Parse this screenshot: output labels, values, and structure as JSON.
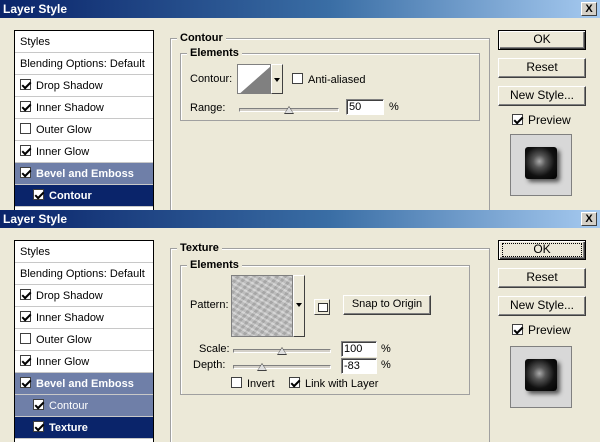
{
  "window1": {
    "title": "Layer Style",
    "close": "X",
    "sidebar": [
      {
        "label": "Styles",
        "checkbox": false,
        "checked": false,
        "state": "normal"
      },
      {
        "label": "Blending Options: Default",
        "checkbox": false,
        "checked": false,
        "state": "normal"
      },
      {
        "label": "Drop Shadow",
        "checkbox": true,
        "checked": true,
        "state": "normal"
      },
      {
        "label": "Inner Shadow",
        "checkbox": true,
        "checked": true,
        "state": "normal"
      },
      {
        "label": "Outer Glow",
        "checkbox": true,
        "checked": false,
        "state": "normal"
      },
      {
        "label": "Inner Glow",
        "checkbox": true,
        "checked": true,
        "state": "normal"
      },
      {
        "label": "Bevel and Emboss",
        "checkbox": true,
        "checked": true,
        "state": "selected-parent"
      },
      {
        "label": "Contour",
        "checkbox": true,
        "checked": true,
        "state": "selected"
      }
    ],
    "panel_title": "Contour",
    "group_title": "Elements",
    "contour_label": "Contour:",
    "anti_aliased_label": "Anti-aliased",
    "anti_aliased_checked": false,
    "range_label": "Range:",
    "range_value": "50",
    "range_unit": "%",
    "range_level_percent": 50,
    "ok_label": "OK",
    "reset_label": "Reset",
    "new_style_label": "New Style...",
    "preview_label": "Preview",
    "preview_checked": true
  },
  "window2": {
    "title": "Layer Style",
    "close": "X",
    "sidebar": [
      {
        "label": "Styles",
        "checkbox": false,
        "checked": false,
        "state": "normal"
      },
      {
        "label": "Blending Options: Default",
        "checkbox": false,
        "checked": false,
        "state": "normal"
      },
      {
        "label": "Drop Shadow",
        "checkbox": true,
        "checked": true,
        "state": "normal"
      },
      {
        "label": "Inner Shadow",
        "checkbox": true,
        "checked": true,
        "state": "normal"
      },
      {
        "label": "Outer Glow",
        "checkbox": true,
        "checked": false,
        "state": "normal"
      },
      {
        "label": "Inner Glow",
        "checkbox": true,
        "checked": true,
        "state": "normal"
      },
      {
        "label": "Bevel and Emboss",
        "checkbox": true,
        "checked": true,
        "state": "selected-parent"
      },
      {
        "label": "Contour",
        "checkbox": true,
        "checked": true,
        "state": "sub-selected"
      },
      {
        "label": "Texture",
        "checkbox": true,
        "checked": true,
        "state": "selected"
      }
    ],
    "panel_title": "Texture",
    "group_title": "Elements",
    "pattern_label": "Pattern:",
    "snap_label": "Snap to Origin",
    "scale_label": "Scale:",
    "scale_value": "100",
    "scale_unit": "%",
    "scale_level_percent": 50,
    "depth_label": "Depth:",
    "depth_value": "-83",
    "depth_unit": "%",
    "depth_level_percent": 30,
    "invert_label": "Invert",
    "invert_checked": false,
    "link_label": "Link with Layer",
    "link_checked": true,
    "ok_label": "OK",
    "reset_label": "Reset",
    "new_style_label": "New Style...",
    "preview_label": "Preview",
    "preview_checked": true
  }
}
